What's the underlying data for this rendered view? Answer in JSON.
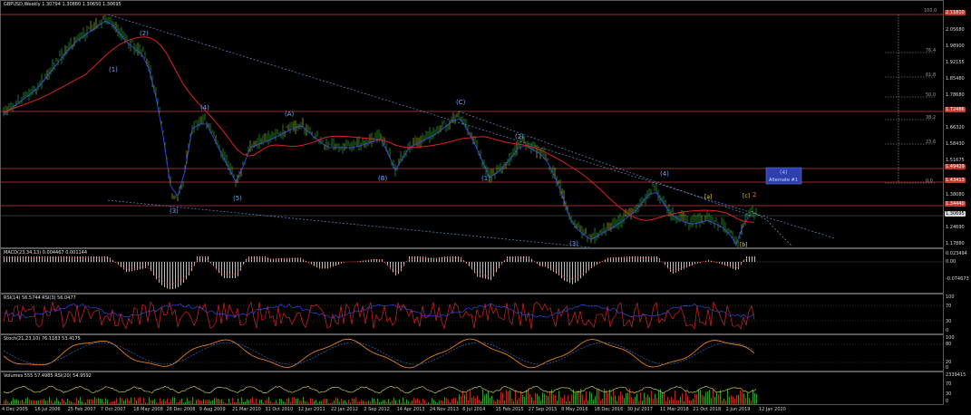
{
  "main": {
    "title": "GBPUSD,Weekly  1.30794 1.30880 1.30650 1.30695",
    "axis_labels": [
      "2.05680",
      "1.98900",
      "1.92155",
      "1.85480",
      "1.78680",
      "1.72160",
      "1.66320",
      "1.58430",
      "1.51675",
      "1.44900",
      "1.38080",
      "1.31285",
      "1.24690",
      "1.17880"
    ],
    "hline_tags": [
      {
        "text": "2.11810",
        "color": "#c0392b"
      },
      {
        "text": "1.72486",
        "color": "#c0392b"
      },
      {
        "text": "1.49429",
        "color": "#c0392b"
      },
      {
        "text": "1.43413",
        "color": "#c0392b"
      },
      {
        "text": "1.34440",
        "color": "#c0392b"
      },
      {
        "text": "1.30695",
        "color": "#d8d8d8"
      }
    ],
    "fib_levels": [
      "100.0",
      "76.4",
      "61.8",
      "50.0",
      "38.2",
      "23.6",
      "0.0"
    ],
    "wave_labels": {
      "w1": "(1)",
      "w2": "(2)",
      "w3": "(3)",
      "w4a": "(4)",
      "w5": "(5)",
      "wa": "(A)",
      "wb": "(B)",
      "wc": "(C)",
      "w1b": "(1)",
      "w2b": "(2)",
      "w3b": "(3)",
      "w4b": "(4)",
      "ya": "[a]",
      "yb": "[b]",
      "yc": "[c]",
      "y2": "2"
    },
    "alternate_box": {
      "line1": "(4)",
      "line2": "Alternate #1"
    }
  },
  "macd": {
    "title": "MACD(23,34,13) 0.004467 0.001144",
    "axis_labels": [
      "0.023494",
      "0.00",
      "-0.074673"
    ]
  },
  "rsi": {
    "title": "RSI(14) 56.5744  RSI(3) 56.0477",
    "axis_labels": [
      "100",
      "70",
      "30",
      "0"
    ]
  },
  "stoch": {
    "title": "Stoch(21,23,10) 76.1183 53.4175",
    "axis_labels": [
      "100",
      "80",
      "20",
      "0"
    ]
  },
  "volumes": {
    "title": "Volumes 555 57.4985  RSI(20) 54.9592",
    "axis_labels": [
      "2339415",
      "70",
      "30",
      "0"
    ]
  },
  "xaxis": [
    "4 Dec 2005",
    "16 Jul 2006",
    "25 Feb 2007",
    "7 Oct 2007",
    "18 May 2008",
    "28 Dec 2008",
    "9 Aug 2009",
    "21 Mar 2010",
    "31 Oct 2010",
    "12 Jun 2011",
    "22 Jan 2012",
    "2 Sep 2012",
    "14 Apr 2013",
    "24 Nov 2013",
    "6 Jul 2014",
    "15 Feb 2015",
    "27 Sep 2015",
    "8 May 2016",
    "18 Dec 2016",
    "30 Jul 2017",
    "11 Mar 2018",
    "21 Oct 2018",
    "2 Jun 2019",
    "12 Jan 2020"
  ],
  "colors": {
    "background": "#000000",
    "bull": "#33cc33",
    "bear": "#ff4040",
    "ma": "#e02020",
    "wave": "#6aa7ff",
    "hline": "#d04040",
    "rsi": "#e02020",
    "stoch": "#ff8c1a",
    "volume_line": "#e8e85a"
  }
}
